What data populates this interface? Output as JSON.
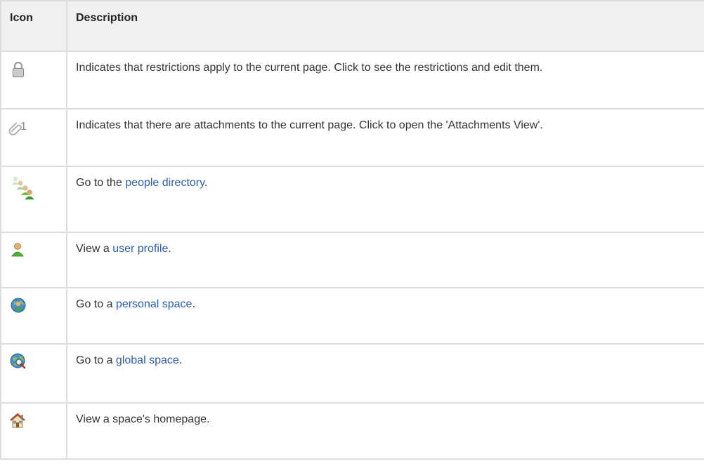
{
  "table": {
    "headers": {
      "icon": "Icon",
      "description": "Description"
    },
    "rows": [
      {
        "icon": "padlock-icon",
        "text_before": "Indicates that restrictions apply to the current page. Click to see the restrictions and edit them.",
        "link": "",
        "text_after": ""
      },
      {
        "icon": "paperclip-icon",
        "icon_count": "1",
        "text_before": "Indicates that there are attachments to the current page. Click to open the 'Attachments View'.",
        "link": "",
        "text_after": ""
      },
      {
        "icon": "people-directory-icon",
        "text_before": "Go to the ",
        "link": "people directory",
        "text_after": "."
      },
      {
        "icon": "user-profile-icon",
        "text_before": "View a ",
        "link": "user profile",
        "text_after": "."
      },
      {
        "icon": "personal-space-icon",
        "text_before": "Go to a ",
        "link": "personal space",
        "text_after": "."
      },
      {
        "icon": "global-space-icon",
        "text_before": "Go to a ",
        "link": "global space",
        "text_after": "."
      },
      {
        "icon": "home-icon",
        "text_before": "View a space's homepage.",
        "link": "",
        "text_after": ""
      }
    ]
  },
  "colors": {
    "link": "#2a5db0",
    "header_bg": "#f0f0f0",
    "border": "#dddddd",
    "text": "#333333"
  }
}
